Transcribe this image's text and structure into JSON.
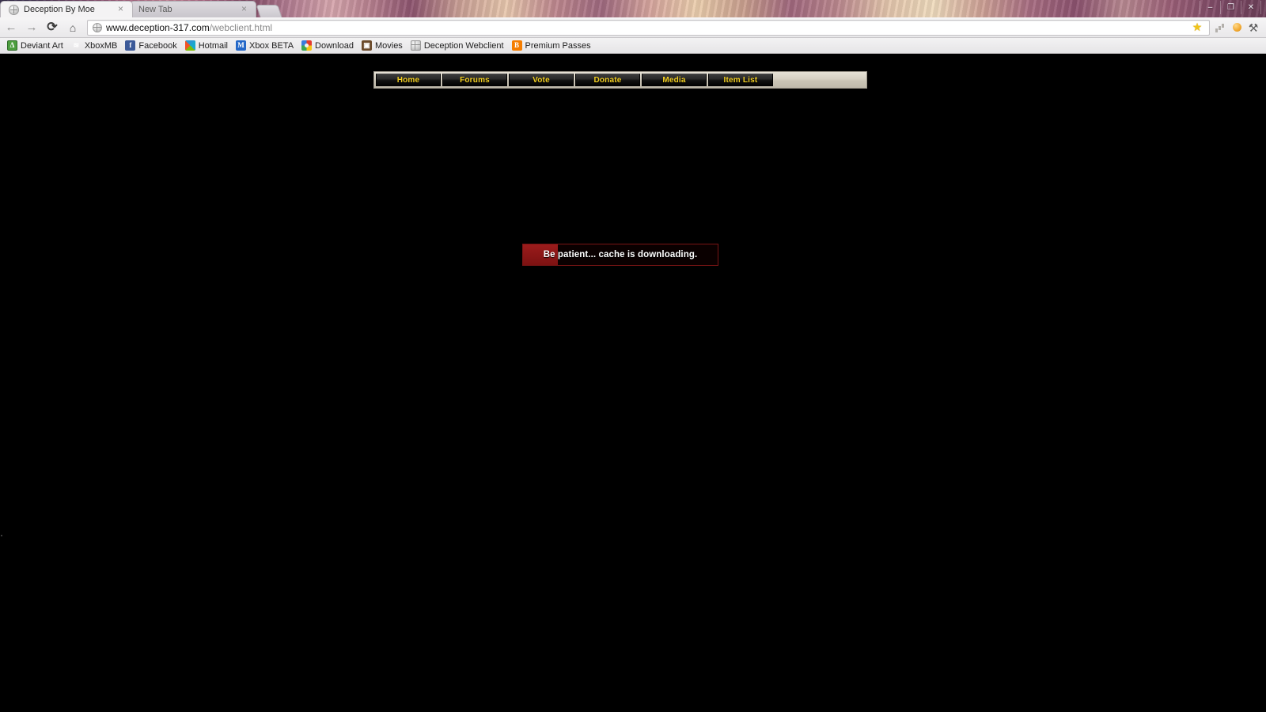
{
  "window": {
    "controls": [
      {
        "name": "minimize",
        "glyph": "–"
      },
      {
        "name": "restore",
        "glyph": "❐"
      },
      {
        "name": "close",
        "glyph": "✕"
      }
    ]
  },
  "tabs": [
    {
      "title": "Deception By Moe",
      "favicon": "globe-icon",
      "active": true,
      "close": "×"
    },
    {
      "title": "New Tab",
      "favicon": "none",
      "active": false,
      "close": "×"
    }
  ],
  "toolbar": {
    "back": "←",
    "forward": "→",
    "reload": "⟳",
    "home": "⌂",
    "omnibox": {
      "icon": "globe-icon",
      "host": "www.deception-317.com",
      "path": "/webclient.html",
      "bookmark_star": "★"
    },
    "extensions": [
      {
        "name": "signal-bars-icon"
      },
      {
        "name": "orange-dot-icon"
      },
      {
        "name": "wrench-menu-icon",
        "glyph": "⚒"
      }
    ]
  },
  "bookmarks": [
    {
      "label": "Deviant Art",
      "icon": "deviantart-icon",
      "glyph": "Δ"
    },
    {
      "label": "XboxMB",
      "icon": "xboxmb-icon",
      "glyph": "≋"
    },
    {
      "label": "Facebook",
      "icon": "facebook-icon",
      "glyph": "f"
    },
    {
      "label": "Hotmail",
      "icon": "hotmail-icon",
      "glyph": ""
    },
    {
      "label": "Xbox BETA",
      "icon": "xbox-icon",
      "glyph": "M"
    },
    {
      "label": "Download",
      "icon": "download-icon",
      "glyph": ""
    },
    {
      "label": "Movies",
      "icon": "movies-icon",
      "glyph": "▣"
    },
    {
      "label": "Deception Webclient",
      "icon": "globe-icon",
      "glyph": ""
    },
    {
      "label": "Premium Passes",
      "icon": "blogger-icon",
      "glyph": "B"
    }
  ],
  "site": {
    "nav": [
      {
        "label": "Home"
      },
      {
        "label": "Forums"
      },
      {
        "label": "Vote"
      },
      {
        "label": "Donate"
      },
      {
        "label": "Media"
      },
      {
        "label": "Item List"
      }
    ],
    "loader": {
      "text": "Be patient... cache is downloading.",
      "progress_percent": 18
    }
  },
  "colors": {
    "page_background": "#000000",
    "nav_text": "#f2cf22",
    "nav_frame": "#d6d0c2",
    "loader_fill": "#8d1717",
    "loader_border": "#7a1414",
    "loader_text": "#ffffff"
  }
}
